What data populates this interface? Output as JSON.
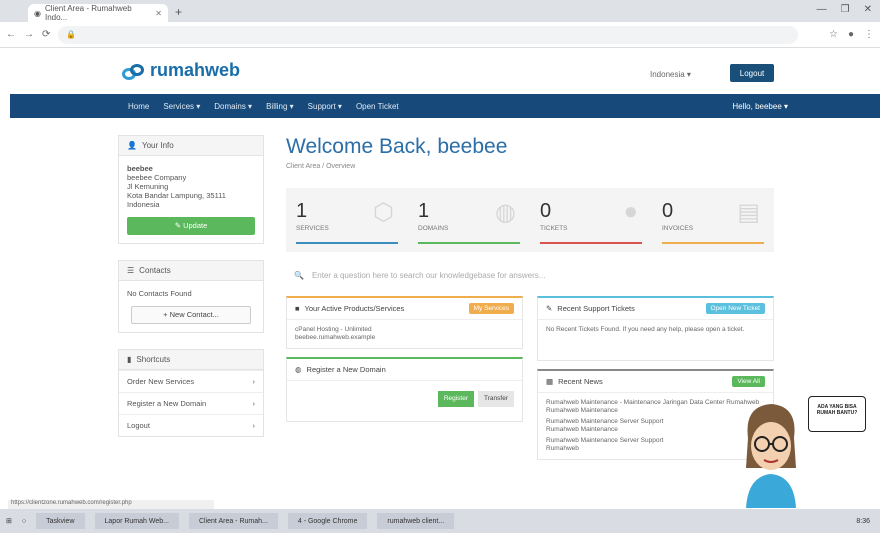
{
  "browser": {
    "tab_title": "Client Area - Rumahweb Indo...",
    "url": "",
    "window_controls": [
      "—",
      "❐",
      "✕"
    ]
  },
  "header": {
    "brand": "rumahweb",
    "language": "Indonesia ▾",
    "login": "Logout"
  },
  "nav": {
    "items": [
      "Home",
      "Services ▾",
      "Domains ▾",
      "Billing ▾",
      "Support ▾",
      "Open Ticket"
    ],
    "user": "Hello, beebee ▾"
  },
  "sidebar": {
    "info_title": "Your Info",
    "info_lines": [
      "beebee",
      "beebee Company",
      "Jl Kemuning",
      "Kota Bandar Lampung, 35111",
      "Indonesia"
    ],
    "update_btn": "✎ Update",
    "contacts_title": "Contacts",
    "contacts_text": "No Contacts Found",
    "new_contact_btn": "+ New Contact...",
    "shortcuts_title": "Shortcuts",
    "shortcuts": [
      {
        "label": "Order New Services",
        "arrow": "›"
      },
      {
        "label": "Register a New Domain",
        "arrow": "›"
      },
      {
        "label": "Logout",
        "arrow": "›"
      }
    ]
  },
  "main": {
    "title": "Welcome Back, beebee",
    "breadcrumb": "Client Area / Overview",
    "stats": [
      {
        "value": "1",
        "label": "SERVICES",
        "color": "#3b8dbd"
      },
      {
        "value": "1",
        "label": "DOMAINS",
        "color": "#5cb85c"
      },
      {
        "value": "0",
        "label": "TICKETS",
        "color": "#d9534f"
      },
      {
        "value": "0",
        "label": "INVOICES",
        "color": "#f0ad4e"
      }
    ],
    "search_placeholder": "Enter a question here to search our knowledgebase for answers...",
    "cards_left": [
      {
        "title": "Your Active Products/Services",
        "badge": "My Services",
        "badge_color": "#f0ad4e",
        "border": "#f0ad4e",
        "body": [
          "cPanel Hosting - Unlimited",
          "beebee.rumahweb.example"
        ]
      },
      {
        "title": "Register a New Domain",
        "border": "#5cb85c",
        "register_btn": "Register",
        "transfer_btn": "Transfer"
      }
    ],
    "cards_right": [
      {
        "title": "Recent Support Tickets",
        "badge": "Open New Ticket",
        "badge_color": "#5bc0de",
        "border": "#5bc0de",
        "body": [
          "No Recent Tickets Found. If you need any help, please open a ticket."
        ]
      },
      {
        "title": "Recent News",
        "badge": "View All",
        "badge_color": "#5cb85c",
        "border": "#888",
        "body": [
          "Rumahweb Maintenance - Maintenance Jaringan Data Center Rumahweb",
          "Rumahweb Maintenance",
          "Rumahweb Maintenance Server Support",
          "Rumahweb Maintenance",
          "Rumahweb Maintenance Server Support",
          "Rumahweb"
        ]
      }
    ]
  },
  "mascot_bubble": "ADA YANG BISA RUMAH BANTU?",
  "status_url": "https://clientzone.rumahweb.com/register.php",
  "taskbar": {
    "items": [
      "Taskview",
      "Lapor Rumah Web...",
      "Client Area - Rumah...",
      "4 - Google Chrome",
      "rumahweb client..."
    ],
    "time": "8:36"
  }
}
